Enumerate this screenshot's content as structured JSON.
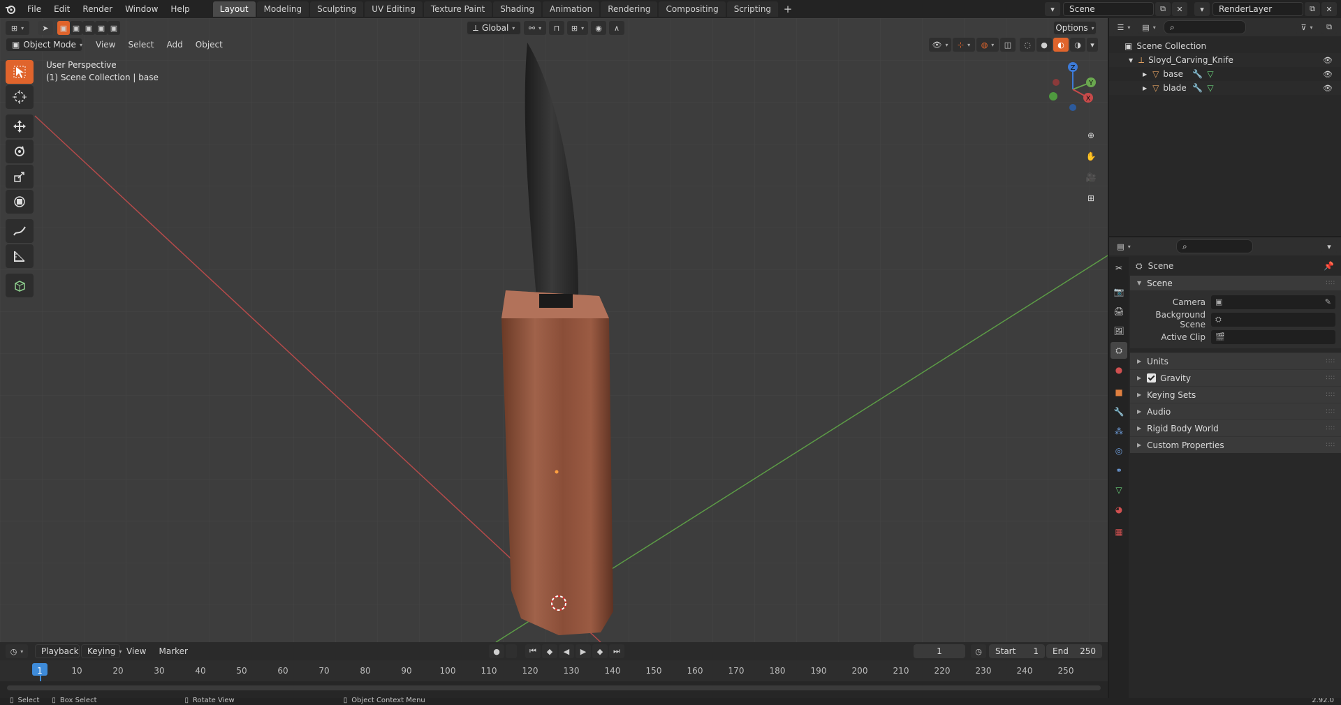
{
  "topbar": {
    "menus": [
      "File",
      "Edit",
      "Render",
      "Window",
      "Help"
    ],
    "workspaces": [
      "Layout",
      "Modeling",
      "Sculpting",
      "UV Editing",
      "Texture Paint",
      "Shading",
      "Animation",
      "Rendering",
      "Compositing",
      "Scripting"
    ],
    "active_workspace": "Layout",
    "add_tab": "+",
    "scene_name": "Scene",
    "render_layer": "RenderLayer"
  },
  "viewport": {
    "header": {
      "transform_orientation": "Global",
      "options_label": "Options",
      "mode": "Object Mode",
      "menus": [
        "View",
        "Select",
        "Add",
        "Object"
      ]
    },
    "overlay_title": "User Perspective",
    "overlay_subtitle": "(1) Scene Collection | base",
    "gizmo": {
      "z": "Z",
      "y": "Y",
      "x": "X"
    }
  },
  "timeline": {
    "menus": [
      "Playback",
      "Keying",
      "View",
      "Marker"
    ],
    "current_frame": "1",
    "start_label": "Start",
    "start_value": "1",
    "end_label": "End",
    "end_value": "250",
    "ticks": [
      "1",
      "10",
      "20",
      "30",
      "40",
      "50",
      "60",
      "70",
      "80",
      "90",
      "100",
      "110",
      "120",
      "130",
      "140",
      "150",
      "160",
      "170",
      "180",
      "190",
      "200",
      "210",
      "220",
      "230",
      "240",
      "250"
    ]
  },
  "statusbar": {
    "select": "Select",
    "box_select": "Box Select",
    "rotate_view": "Rotate View",
    "context_menu": "Object Context Menu",
    "version": "2.92.0"
  },
  "outliner": {
    "root": "Scene Collection",
    "collection": "Sloyd_Carving_Knife",
    "objects": [
      "base",
      "blade"
    ]
  },
  "properties": {
    "context": "Scene",
    "panel_title": "Scene",
    "rows": [
      {
        "label": "Camera"
      },
      {
        "label": "Background Scene"
      },
      {
        "label": "Active Clip"
      }
    ],
    "subpanels": [
      "Units",
      "Gravity",
      "Keying Sets",
      "Audio",
      "Rigid Body World",
      "Custom Properties"
    ]
  },
  "colors": {
    "accent": "#e0642c",
    "axis_x": "#c84a4a",
    "axis_y": "#6aa84f",
    "axis_z": "#3d7bd8"
  }
}
